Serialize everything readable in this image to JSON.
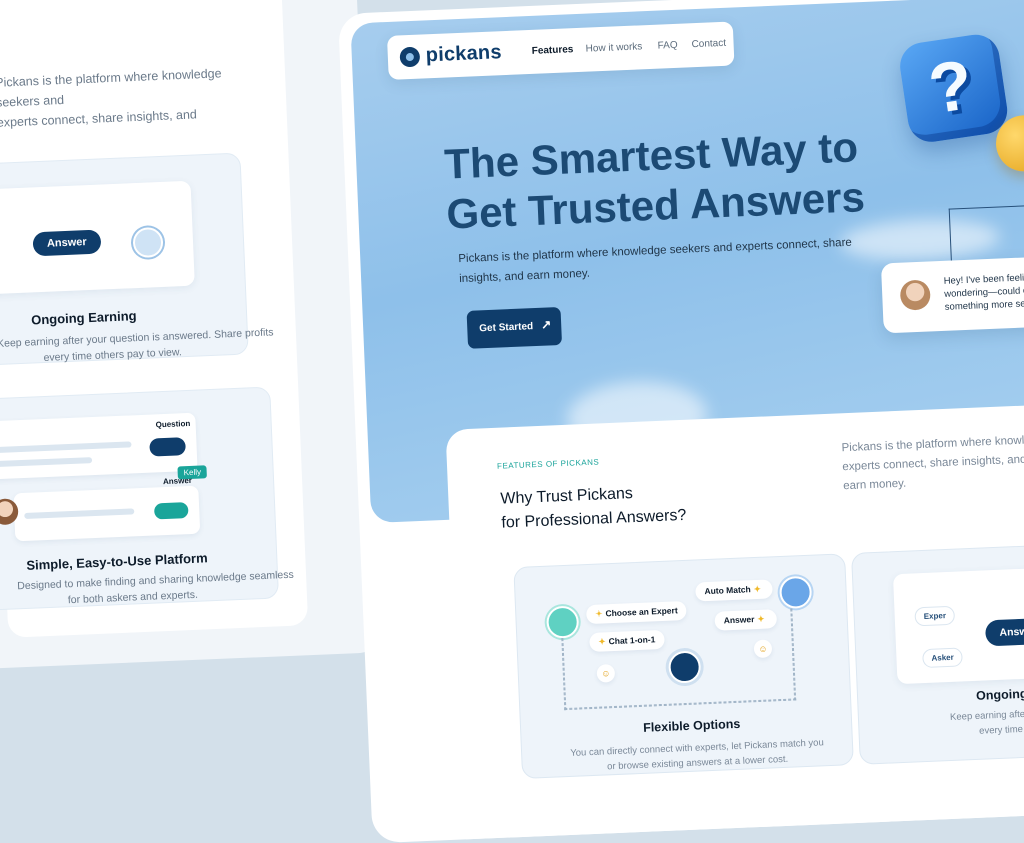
{
  "left_panel": {
    "desc_lines": [
      "Pickans is the platform where knowledge seekers and",
      "experts connect, share insights, and"
    ],
    "earning_card": {
      "answer_label": "Answer",
      "title": "Ongoing Earning",
      "desc_lines": [
        "Keep earning after your question is answered. Share profits",
        "every time others pay to view."
      ]
    },
    "platform_card": {
      "question_label": "Question",
      "answer_label": "Answer",
      "cursor_tag": "Kelly",
      "title": "Simple, Easy-to-Use Platform",
      "desc_lines": [
        "Designed to make finding and sharing knowledge seamless",
        "for both askers and experts."
      ]
    }
  },
  "nav": {
    "logo": "pickans",
    "links": [
      "Features",
      "How it works",
      "FAQ",
      "Contact"
    ],
    "active": "Features"
  },
  "hero": {
    "title_lines": [
      "The Smartest Way to",
      "Get Trusted Answers"
    ],
    "desc_lines": [
      "Pickans is the platform where knowledge seekers and experts connect, share",
      "insights, and earn money."
    ],
    "cta_label": "Get Started",
    "cta_icon": "arrow-up-right-icon",
    "chat_lines": [
      "Hey! I've been feeling a bit o",
      "wondering—could constant",
      "something more serious, o"
    ]
  },
  "features": {
    "eyebrow": "FEATURES OF PICKANS",
    "title_lines": [
      "Why Trust Pickans",
      "for Professional Answers?"
    ],
    "side_lines": [
      "Pickans is the platform where knowledge",
      "experts connect, share insights, and",
      "earn money."
    ],
    "flexible_card": {
      "chips": [
        "Choose an Expert",
        "Auto Match",
        "Chat 1-on-1",
        "Answer"
      ],
      "title": "Flexible Options",
      "desc_lines": [
        "You can directly connect with experts, let Pickans match you",
        "or browse existing answers at a lower cost."
      ]
    },
    "earning_card": {
      "expert_label": "Exper",
      "asker_label": "Asker",
      "answer_label": "Answer",
      "title": "Ongoing Earn",
      "desc_lines": [
        "Keep earning after your question",
        "every time others p"
      ]
    }
  },
  "colors": {
    "brand_navy": "#0f3d6b",
    "accent_teal": "#19a39a",
    "hero_sky": "#8ec0ea",
    "coin_gold": "#f0b92a"
  }
}
